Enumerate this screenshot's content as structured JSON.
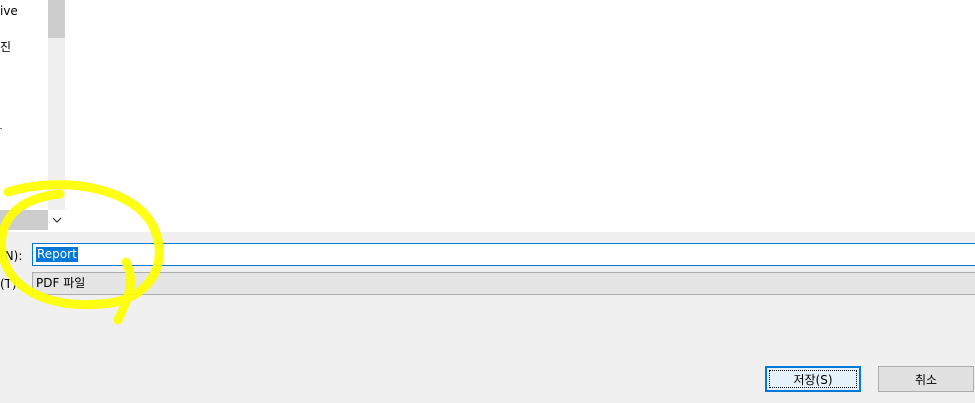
{
  "nav": {
    "items": [
      "ive",
      "진"
    ]
  },
  "form": {
    "filename_label": "(N):",
    "filename_value": "Report",
    "filetype_label": "(T):",
    "filetype_value": "PDF 파일"
  },
  "buttons": {
    "save": "저장(S)",
    "cancel": "취소"
  },
  "colors": {
    "accent": "#0078d7",
    "highlight": "#ffff00"
  }
}
